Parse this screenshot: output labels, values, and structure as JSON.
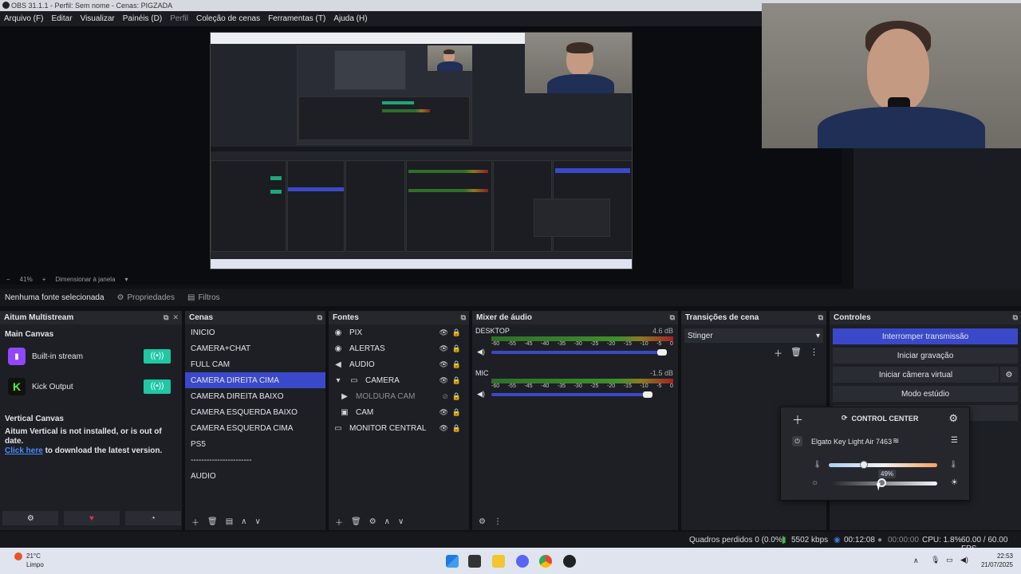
{
  "window": {
    "title": "OBS 31.1.1 - Perfil: Sem nome - Cenas: PIGZADA"
  },
  "menu": [
    {
      "label": "Arquivo (F)",
      "dim": false
    },
    {
      "label": "Editar",
      "dim": false
    },
    {
      "label": "Visualizar",
      "dim": false
    },
    {
      "label": "Painéis (D)",
      "dim": false
    },
    {
      "label": "Perfil",
      "dim": true
    },
    {
      "label": "Coleção de cenas",
      "dim": false
    },
    {
      "label": "Ferramentas (T)",
      "dim": false
    },
    {
      "label": "Ajuda (H)",
      "dim": false
    }
  ],
  "preview": {
    "zoom": "41%",
    "zoom_plus": "+",
    "resize_label": "Dimensionar à janela"
  },
  "source_bar": {
    "no_source": "Nenhuma fonte selecionada",
    "properties": "Propriedades",
    "filters": "Filtros"
  },
  "multistream": {
    "title": "Aitum Multistream",
    "main_canvas": "Main Canvas",
    "outputs": [
      {
        "label": "Built-in stream",
        "icon": "twitch-icon",
        "color": "#9146ff"
      },
      {
        "label": "Kick Output",
        "icon": "kick-icon",
        "color": "#53fc18"
      }
    ],
    "vertical_title": "Vertical Canvas",
    "vertical_msg": "Aitum Vertical is not installed, or is out of date.",
    "click_here": "Click here",
    "download_msg": "to download the latest version."
  },
  "scenes": {
    "title": "Cenas",
    "items": [
      "INICIO",
      "CAMERA+CHAT",
      "FULL CAM",
      "CAMERA DIREITA CIMA",
      "CAMERA DIREITA BAIXO",
      "CAMERA ESQUERDA BAIXO",
      "CAMERA ESQUERDA CIMA",
      "PS5",
      "-----------------------",
      "AUDIO"
    ],
    "selected_index": 3
  },
  "sources": {
    "title": "Fontes",
    "items": [
      {
        "label": "PIX",
        "icon": "globe-icon",
        "indent": 0,
        "dim": false
      },
      {
        "label": "ALERTAS",
        "icon": "globe-icon",
        "indent": 0,
        "dim": false
      },
      {
        "label": "AUDIO",
        "icon": "speaker-icon",
        "indent": 0,
        "dim": false
      },
      {
        "label": "CAMERA",
        "icon": "folder-icon",
        "indent": 1,
        "dim": false
      },
      {
        "label": "MOLDURA CAM",
        "icon": "play-icon",
        "indent": 2,
        "dim": true
      },
      {
        "label": "CAM",
        "icon": "camera-icon",
        "indent": 2,
        "dim": false
      },
      {
        "label": "MONITOR CENTRAL",
        "icon": "monitor-icon",
        "indent": 0,
        "dim": false
      }
    ]
  },
  "mixer": {
    "title": "Mixer de áudio",
    "ticks": [
      "-60",
      "-55",
      "-45",
      "-40",
      "-35",
      "-30",
      "-25",
      "-20",
      "-15",
      "-10",
      "-5",
      "0"
    ],
    "channels": [
      {
        "name": "DESKTOP",
        "db": "4.6 dB",
        "volume": 1.0
      },
      {
        "name": "MIC",
        "db": "-1.5 dB",
        "volume": 0.92
      }
    ]
  },
  "transitions": {
    "title": "Transições de cena",
    "selected": "Stinger"
  },
  "controls": {
    "title": "Controles",
    "buttons": [
      "Interromper transmissão",
      "Iniciar gravação",
      "Iniciar câmera virtual",
      "Modo estúdio"
    ]
  },
  "control_center": {
    "title": "CONTROL CENTER",
    "device": "Elgato Key Light Air 7463",
    "brightness_label": "49%",
    "brightness": 0.49,
    "temperature": 0.32
  },
  "status": {
    "dropped": "Quadros perdidos 0 (0.0%)",
    "bitrate": "5502 kbps",
    "stream_time": "00:12:08",
    "rec_time": "00:00:00",
    "cpu": "CPU: 1.8%",
    "fps": "60.00 / 60.00 FPS"
  },
  "taskbar": {
    "temp": "21°C",
    "weather": "Limpo",
    "time": "22:53",
    "date": "21/07/2025"
  },
  "colors": {
    "accent": "#3a49c9",
    "toggle": "#1fc7a4",
    "panel": "#1d1f24",
    "heart": "#e0304a"
  }
}
